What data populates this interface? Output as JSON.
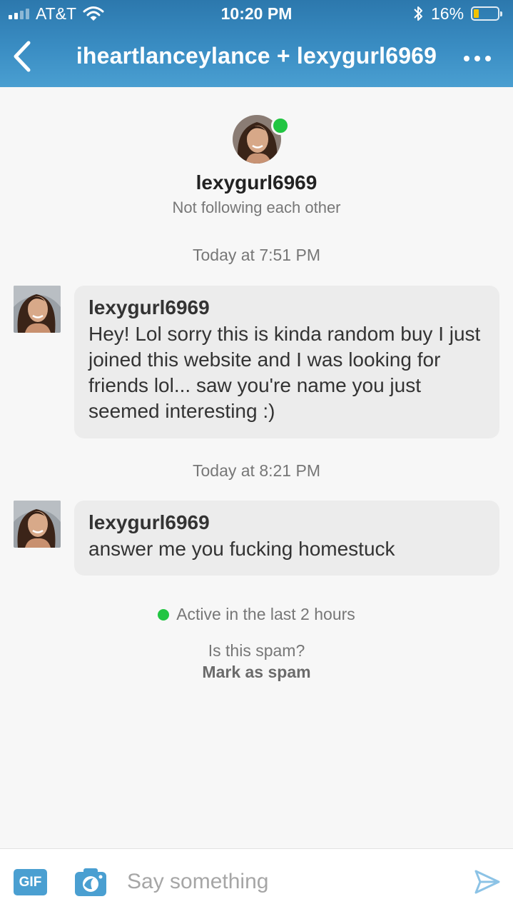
{
  "status_bar": {
    "carrier": "AT&T",
    "time": "10:20 PM",
    "battery": "16%",
    "battery_level": 0.16,
    "signal_bars_filled": 2,
    "signal_bars_total": 4
  },
  "header": {
    "title": "iheartlanceylance + lexygurl6969",
    "back_icon": "chevron-left-icon",
    "more_icon": "more-horizontal-icon"
  },
  "profile": {
    "name": "lexygurl6969",
    "follow_status": "Not following each other",
    "online": true
  },
  "conversation": {
    "groups": [
      {
        "timestamp": "Today at 7:51 PM",
        "sender": "lexygurl6969",
        "text": "Hey! Lol sorry this is kinda random buy I just joined this website and I was looking for friends lol... saw you're name you just seemed interesting :)"
      },
      {
        "timestamp": "Today at 8:21 PM",
        "sender": "lexygurl6969",
        "text": "answer me you fucking homestuck"
      }
    ]
  },
  "activity": {
    "status": "Active in the last 2 hours"
  },
  "spam": {
    "question": "Is this spam?",
    "action": "Mark as spam"
  },
  "composer": {
    "gif_label": "GIF",
    "placeholder": "Say something",
    "camera_icon": "camera-icon",
    "send_icon": "send-icon"
  },
  "colors": {
    "header_blue": "#3a8dc3",
    "accent_blue": "#4a9fd1",
    "online_green": "#22c542",
    "bubble_gray": "#ececec"
  }
}
